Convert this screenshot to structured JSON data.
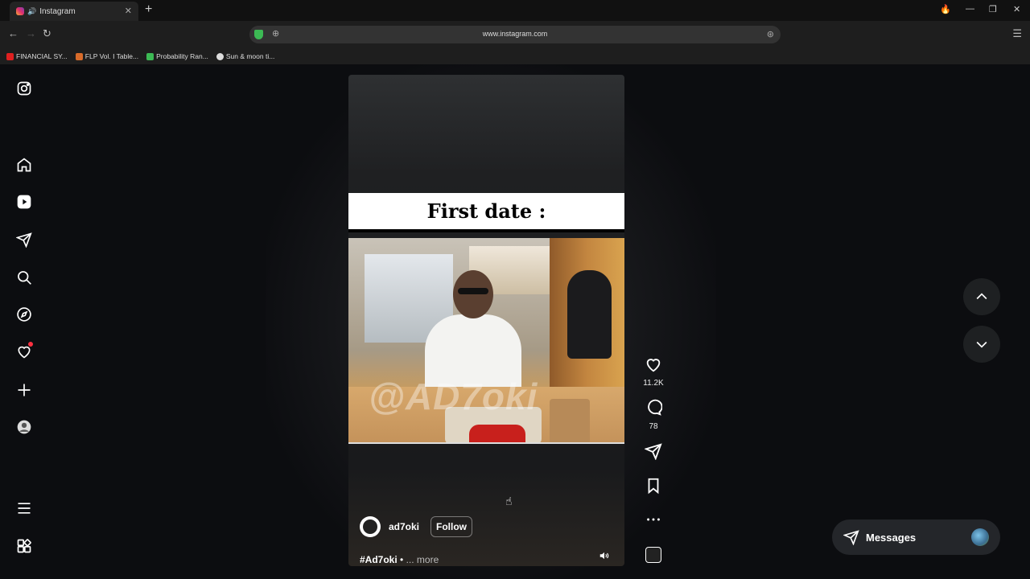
{
  "browser": {
    "tab_title": "Instagram",
    "url": "www.instagram.com",
    "bookmarks": [
      {
        "label": "FINANCIAL SY...",
        "color": "#e02020"
      },
      {
        "label": "FLP Vol. I Table...",
        "color": "#d86b2a"
      },
      {
        "label": "Probability Ran...",
        "color": "#3cba54"
      },
      {
        "label": "Sun & moon ti...",
        "color": "#dddddd"
      }
    ]
  },
  "sidebar": {
    "items": [
      "instagram-logo",
      "home",
      "reels",
      "messages",
      "search",
      "explore",
      "notifications",
      "create",
      "profile",
      "more",
      "also-from-meta"
    ]
  },
  "reel": {
    "caption_text": "First date :",
    "watermark": "@AD7oki",
    "author": "ad7oki",
    "follow_label": "Follow",
    "hashtag": "#Ad7oki",
    "separator": " • ",
    "more_label": "... more"
  },
  "actions": {
    "likes": "11.2K",
    "comments": "78"
  },
  "messages": {
    "label": "Messages"
  },
  "colors": {
    "background": "#0c0d10",
    "notification_dot": "#ff3040"
  }
}
